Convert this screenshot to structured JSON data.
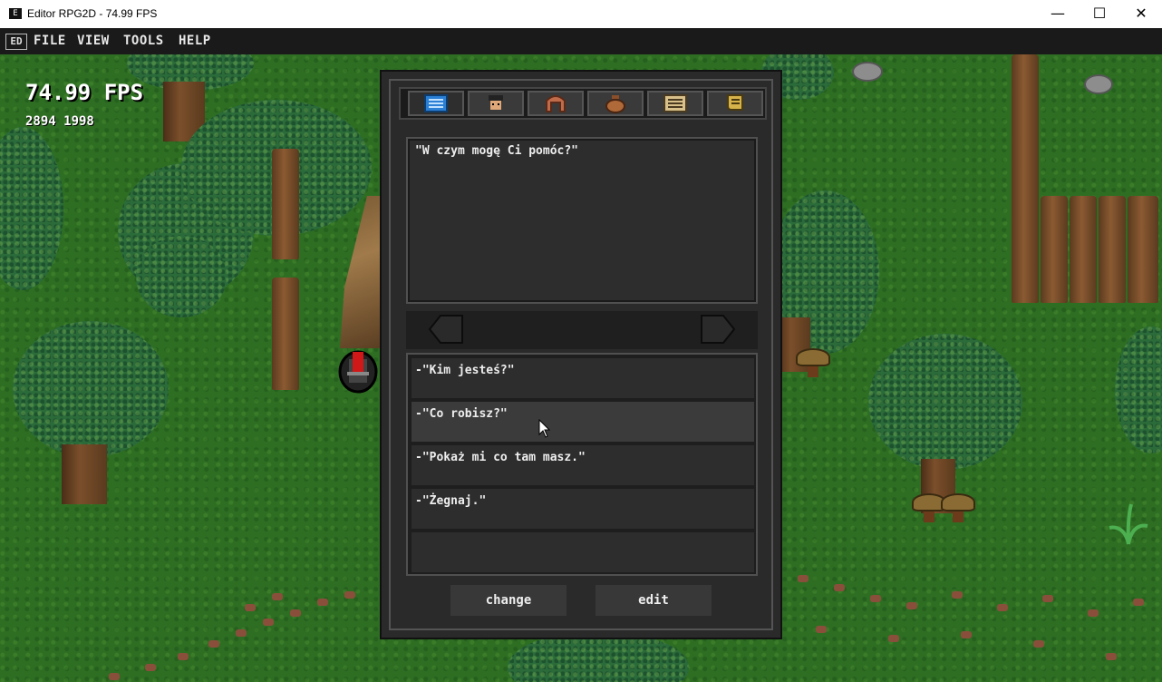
{
  "window": {
    "title": "Editor RPG2D - 74.99 FPS",
    "minimize_glyph": "—",
    "maximize_glyph": "☐",
    "close_glyph": "✕"
  },
  "menubar": {
    "logo": "ED",
    "items": [
      "FILE",
      "VIEW",
      "TOOLS",
      "HELP"
    ]
  },
  "hud": {
    "fps": "74.99 FPS",
    "coords": "2894 1998"
  },
  "dialog": {
    "tabs": [
      {
        "icon": "dialog-list-icon"
      },
      {
        "icon": "npc-face-icon"
      },
      {
        "icon": "hair-icon"
      },
      {
        "icon": "bag-icon"
      },
      {
        "icon": "notes-icon"
      },
      {
        "icon": "scroll-icon"
      }
    ],
    "npc_text": "\"W czym mogę Ci pomóc?\"",
    "responses": [
      "-\"Kim jesteś?\"",
      "-\"Co robisz?\"",
      "-\"Pokaż mi co tam masz.\"",
      "-\"Żegnaj.\""
    ],
    "buttons": {
      "change": "change",
      "edit": "edit"
    }
  },
  "colors": {
    "grass": "#2e6e23",
    "panel": "#2a2a2a",
    "text": "#eeeeee"
  }
}
